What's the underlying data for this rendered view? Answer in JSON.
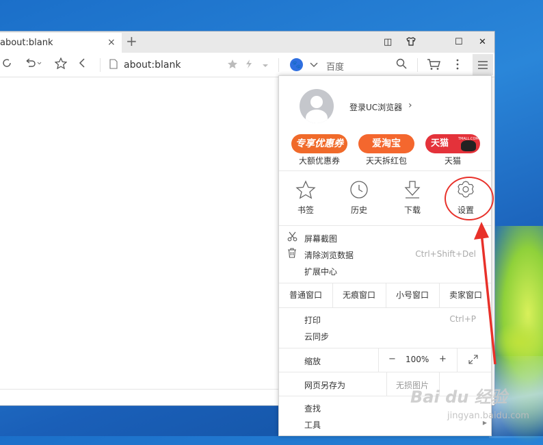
{
  "tab": {
    "title": "about:blank",
    "close": "×",
    "new_tab": "+"
  },
  "window_controls": {
    "restore_small": "◫",
    "shirt": "👕",
    "maximize": "☐",
    "close": "✕"
  },
  "toolbar": {
    "url": "about:blank",
    "search_engine": "百度"
  },
  "menu": {
    "login": "登录UC浏览器",
    "login_arrow": "›",
    "promos": [
      {
        "badge": "专享优惠券",
        "label": "大额优惠券",
        "color": "#f06a2a"
      },
      {
        "badge": "爱淘宝",
        "label": "天天拆红包",
        "color": "#f4672e"
      },
      {
        "badge": "天猫",
        "sub": "TMALL.COM",
        "label": "天猫",
        "color": "#e4323a"
      }
    ],
    "big_items": [
      {
        "label": "书签",
        "icon": "star-icon"
      },
      {
        "label": "历史",
        "icon": "clock-icon"
      },
      {
        "label": "下载",
        "icon": "download-icon"
      },
      {
        "label": "设置",
        "icon": "gear-icon"
      }
    ],
    "screenshot": "屏幕截图",
    "clear_data": "清除浏览数据",
    "clear_shortcut": "Ctrl+Shift+Del",
    "extensions": "扩展中心",
    "windows": [
      "普通窗口",
      "无痕窗口",
      "小号窗口",
      "卖家窗口"
    ],
    "print": "打印",
    "print_shortcut": "Ctrl+P",
    "sync": "云同步",
    "zoom_label": "缩放",
    "zoom_minus": "−",
    "zoom_value": "100%",
    "zoom_plus": "+",
    "save_as": "网页另存为",
    "lossless_image": "无损图片",
    "find": "查找",
    "tools": "工具"
  },
  "watermark": {
    "main": "Bai du 经验",
    "sub": "jingyan.baidu.com"
  },
  "colors": {
    "annotation": "#e8312a",
    "accent": "#2f6fe0"
  }
}
